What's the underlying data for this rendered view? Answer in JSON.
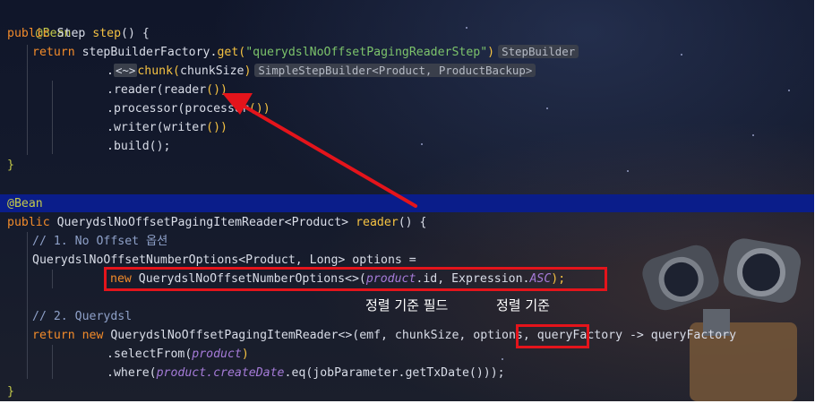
{
  "code": {
    "l1_annotation": "@Bean",
    "l2_kw": "public",
    "l2_type": " Step ",
    "l2_method": "step",
    "l2_rest": "() {",
    "l3_kw": "return",
    "l3_call": " stepBuilderFactory.",
    "l3_get": "get",
    "l3_str": "\"querydslNoOffsetPagingReaderStep\"",
    "l3_hint": "StepBuilder",
    "l4_dot": ".",
    "l4_generic": "<~>",
    "l4_chunk": "chunk",
    "l4_arg": "chunkSize",
    "l4_hint": "SimpleStepBuilder<Product, ProductBackup>",
    "l5_reader": ".reader(",
    "l5_inner": "reader",
    "l5_close": "())",
    "l6_processor": ".processor(",
    "l6_inner": "processor",
    "l6_close": "())",
    "l7_writer": ".writer(",
    "l7_inner": "writer",
    "l7_close": "())",
    "l8_build": ".build();",
    "l9_brace": "}",
    "l11_annotation": "@Bean",
    "l12_kw": "public",
    "l12_type": " QuerydslNoOffsetPagingItemReader",
    "l12_generic": "<Product>",
    "l12_method": " reader",
    "l12_rest": "() {",
    "l13_comment": "// 1. No Offset 옵션",
    "l14_text": "QuerydslNoOffsetNumberOptions<Product, Long> options =",
    "l15_kw": "new",
    "l15_type": " QuerydslNoOffsetNumberOptions<>(",
    "l15_product": "product",
    "l15_id": ".id, Expression.",
    "l15_asc": "ASC",
    "l15_close": ");",
    "l17_comment": "// 2. Querydsl",
    "l18_kw": "return new",
    "l18_text": " QuerydslNoOffsetPagingItemReader<>(emf, chunkSize, ",
    "l18_options": "options,",
    "l18_rest": " queryFactory -> queryFactory",
    "l19_select": ".selectFrom(",
    "l19_product": "product",
    "l19_close": ")",
    "l20_where": ".where(",
    "l20_product": "product",
    "l20_create": ".createDate",
    "l20_rest": ".eq(jobParameter.getTxDate()));",
    "l21_brace": "}"
  },
  "labels": {
    "sort_key_field": "정렬 기준 필드",
    "sort_key": "정렬 기준"
  },
  "colors": {
    "keyword": "#f28b2a",
    "annotation": "#c3c94a",
    "method": "#f5c242",
    "string": "#7cc36b",
    "highlight_band": "#0a1d8a",
    "annotation_box": "#e4141b"
  }
}
